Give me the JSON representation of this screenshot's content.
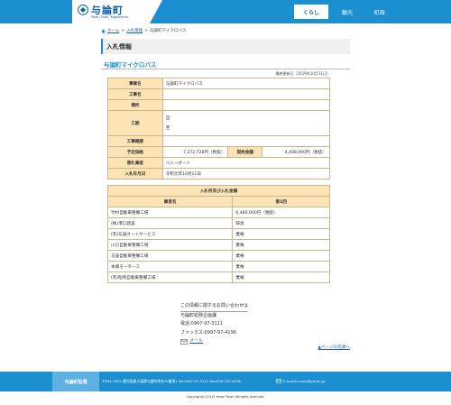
{
  "header": {
    "logo_title": "与論町",
    "logo_sub": "Yoron Town, Kagoshima",
    "nav": [
      "くらし",
      "観光",
      "町政"
    ]
  },
  "breadcrumb": [
    "ホーム",
    "入札情報",
    "与論町マイクロバス"
  ],
  "page_title": "入札情報",
  "section_title": "与論町マイクロバス",
  "updated": "最終更新日［2019年10月11日］",
  "info": {
    "jigyo_label": "事業名",
    "jigyo_value": "与論町マイクロバス",
    "koji_label": "工事名",
    "koji_value": "",
    "basho_label": "場所",
    "basho_value": "",
    "koki_label": "工期",
    "koki_from": "自",
    "koki_to": "至",
    "gaiyo_label": "工事概要",
    "gaiyo_value": "",
    "yotei_label": "予定価格",
    "yotei_value": "7,272,728円（税抜）",
    "keiyaku_label": "契約金額",
    "keiyaku_value": "4,488,000円（税抜）",
    "rakusatsu_label": "落札業者",
    "rakusatsu_value": "ハニーオート",
    "date_label": "入札年月日",
    "date_value": "令和元年10月11日"
  },
  "bid": {
    "title": "入札所及び入札金額",
    "col_name": "業者名",
    "col_round": "第1回",
    "rows": [
      {
        "name": "竹村自動車整備工場",
        "amount": "6,480,000円（税抜）"
      },
      {
        "name": "(株)港口建設",
        "amount": "辞退"
      },
      {
        "name": "(有)与論オートサービス",
        "amount": "棄権"
      },
      {
        "name": "川口自動車整備工場",
        "amount": "棄権"
      },
      {
        "name": "与論自動車整備工場",
        "amount": "棄権"
      },
      {
        "name": "本畑モータース",
        "amount": "棄権"
      },
      {
        "name": "(有)昭和自動車整備工場",
        "amount": "棄権"
      }
    ]
  },
  "contact": {
    "heading": "この情報に関するお問い合わせは",
    "dept": "与論町総務企画課",
    "tel": "電話:0997-97-3111",
    "fax": "ファックス:0997-97-4196",
    "mail": "メール"
  },
  "pagetop": "▲ページの先頭へ",
  "footer": {
    "tab": "与論町役場",
    "address": "〒891-9301 鹿児島県大島郡与論町茶花32番地1    Tel:0997-97-3111    Fax:0997-97-4196",
    "email": "E-mail:k.k.aka@yoron.jp"
  },
  "copyright": "Copyright(C)2015 Yoron Town Allrights reserved."
}
